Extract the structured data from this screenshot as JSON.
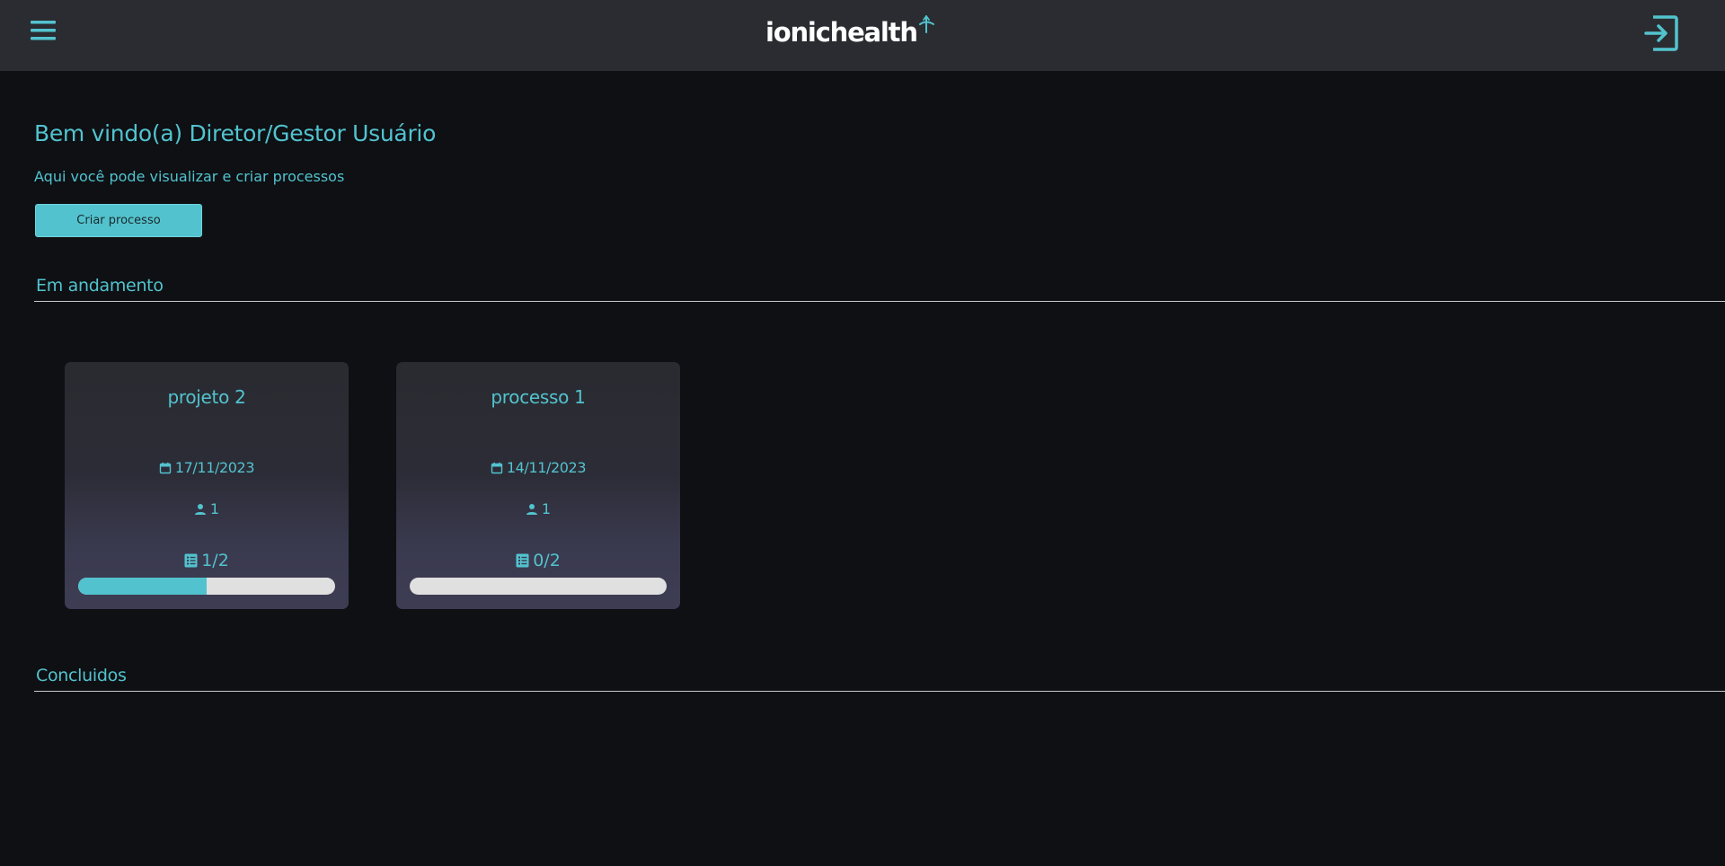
{
  "header": {
    "logo_text": "ionichealth",
    "menu_icon": "hamburger-menu-icon",
    "logout_icon": "logout-icon"
  },
  "main": {
    "welcome": "Bem vindo(a) Diretor/Gestor Usuário",
    "subtitle": "Aqui você pode visualizar e criar processos",
    "create_button": "Criar processo"
  },
  "sections": {
    "in_progress": {
      "title": "Em andamento",
      "cards": [
        {
          "title": "projeto 2",
          "date": "17/11/2023",
          "members": "1",
          "tasks": "1/2",
          "progress": 0.5
        },
        {
          "title": "processo 1",
          "date": "14/11/2023",
          "members": "1",
          "tasks": "0/2",
          "progress": 0
        }
      ]
    },
    "completed": {
      "title": "Concluidos"
    }
  },
  "colors": {
    "accent": "#52c3ce",
    "background": "#0e1014",
    "header_bg": "#2a2c31",
    "progress_track": "#e0e0e0"
  }
}
